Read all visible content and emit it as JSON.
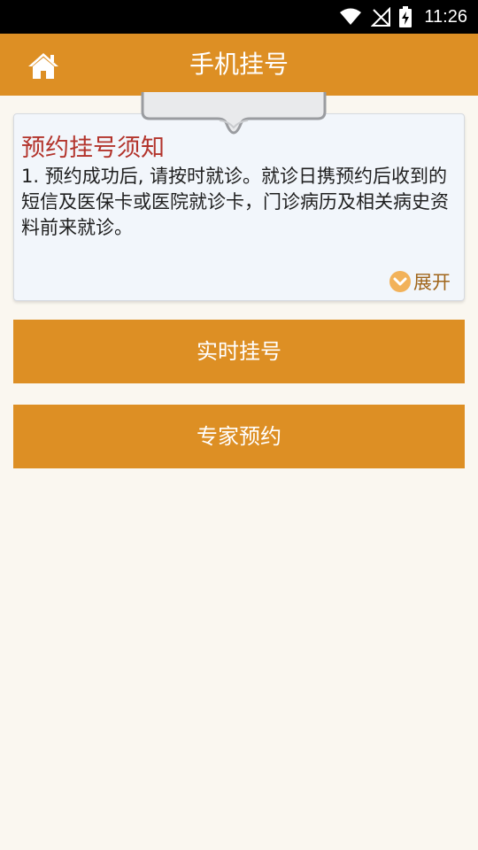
{
  "status_bar": {
    "time": "11:26"
  },
  "header": {
    "title": "手机挂号",
    "home_icon": "home-icon"
  },
  "notice": {
    "title": "预约挂号须知",
    "body": "1. 预约成功后, 请按时就诊。就诊日携预约后收到的短信及医保卡或医院就诊卡，门诊病历及相关病史资料前来就诊。",
    "expand_label": "展开",
    "expand_icon": "chevron-down-circle-icon"
  },
  "actions": {
    "realtime_label": "实时挂号",
    "expert_label": "专家预约"
  },
  "colors": {
    "accent": "#dd8f24",
    "title_red": "#b3342c",
    "background": "#faf7f0",
    "card": "#f2f6fb"
  }
}
